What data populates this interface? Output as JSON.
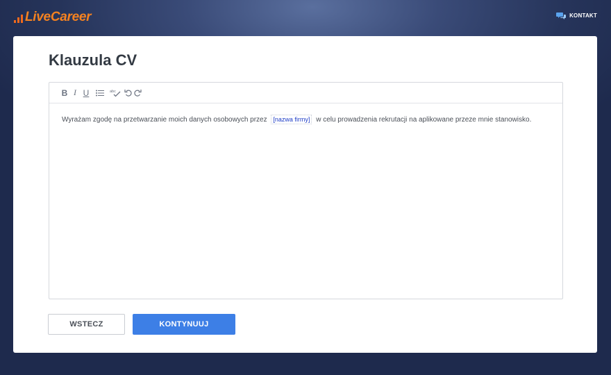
{
  "header": {
    "logo_text": "LiveCareer",
    "contact_label": "KONTAKT",
    "contact_icon": "chat-bubbles-icon",
    "brand_color": "#f58220"
  },
  "main": {
    "title": "Klauzula CV",
    "editor": {
      "toolbar": {
        "bold_label": "B",
        "italic_label": "I",
        "underline_label": "U",
        "list_icon": "bullet-list-icon",
        "spellcheck_icon": "spellcheck-icon",
        "undo_icon": "undo-icon",
        "redo_icon": "redo-icon"
      },
      "content": {
        "before": "Wyrażam zgodę na przetwarzanie moich danych osobowych przez",
        "placeholder": "[nazwa firmy]",
        "after": "w celu prowadzenia rekrutacji na aplikowane przeze mnie stanowisko."
      }
    },
    "buttons": {
      "back_label": "WSTECZ",
      "continue_label": "KONTYNUUJ",
      "continue_color": "#3d7fe6"
    }
  }
}
